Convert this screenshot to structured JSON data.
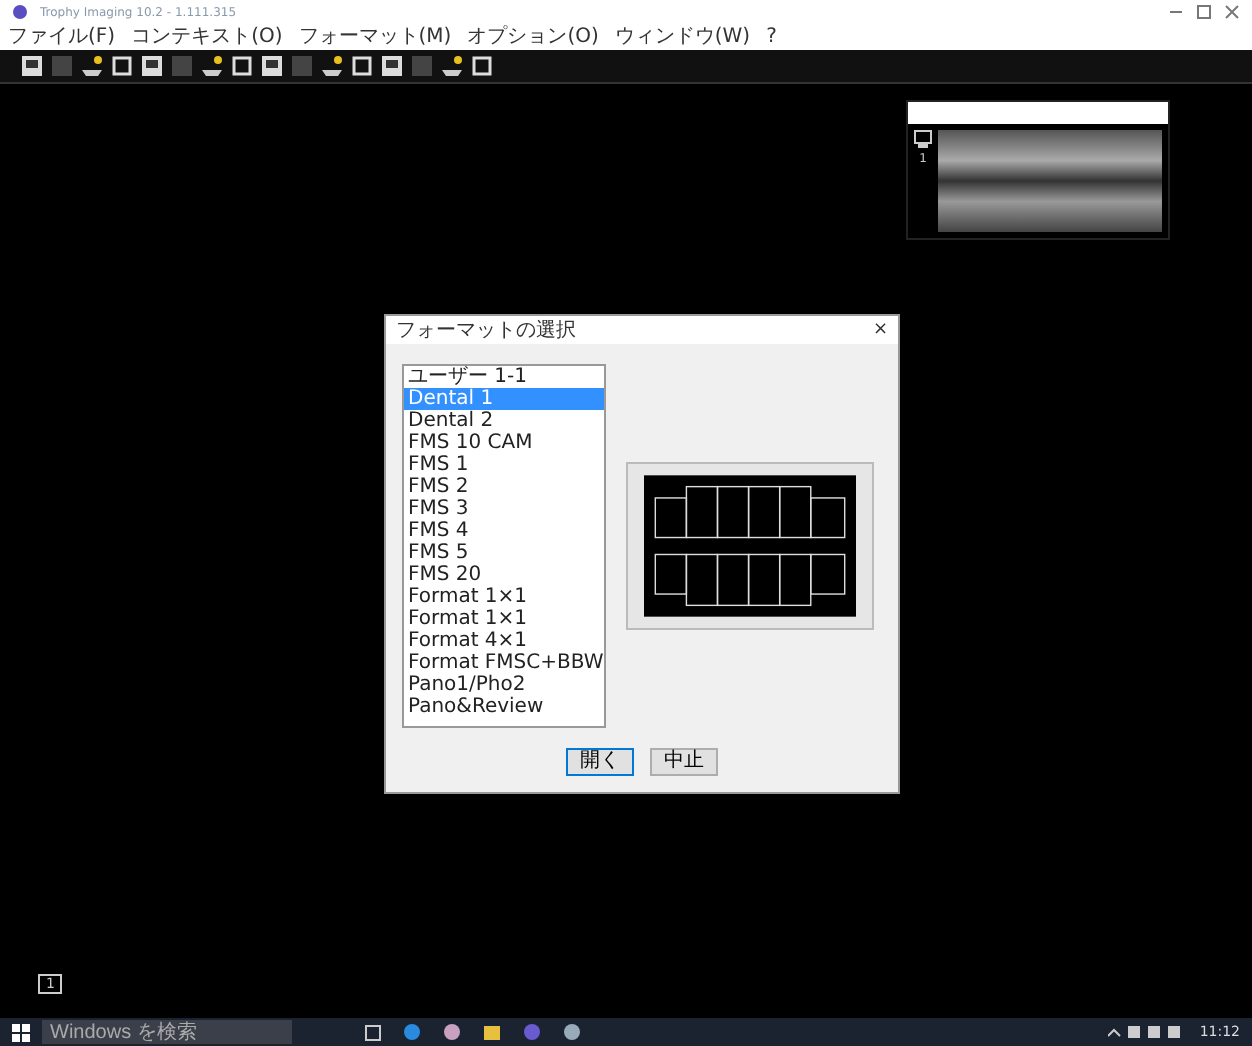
{
  "window": {
    "title": "Trophy Imaging 10.2 - 1.111.315"
  },
  "menu": [
    "ファイル(F)",
    "コンテキスト(O)",
    "フォーマット(M)",
    "オプション(O)",
    "ウィンドウ(W)",
    "?"
  ],
  "dialog": {
    "title": "フォーマットの選択",
    "close": "×",
    "items": [
      {
        "label": "ユーザー 1-1",
        "selected": false
      },
      {
        "label": "Dental 1",
        "selected": true
      },
      {
        "label": "Dental 2",
        "selected": false
      },
      {
        "label": "FMS 10 CAM",
        "selected": false
      },
      {
        "label": "FMS 1",
        "selected": false
      },
      {
        "label": "FMS 2",
        "selected": false
      },
      {
        "label": "FMS 3",
        "selected": false
      },
      {
        "label": "FMS 4",
        "selected": false
      },
      {
        "label": "FMS 5",
        "selected": false
      },
      {
        "label": "FMS 20",
        "selected": false
      },
      {
        "label": "Format 1×1",
        "selected": false
      },
      {
        "label": "Format 1×1",
        "selected": false
      },
      {
        "label": "Format 4×1",
        "selected": false
      },
      {
        "label": "Format FMSC+BBW",
        "selected": false
      },
      {
        "label": "Pano1/Pho2",
        "selected": false
      },
      {
        "label": "Pano&Review",
        "selected": false
      }
    ],
    "buttons": [
      {
        "label": "開く",
        "default": true
      },
      {
        "label": "中止",
        "default": false
      }
    ]
  },
  "thumbnail": {
    "index": "1"
  },
  "page_indicator": "1",
  "taskbar": {
    "search": {
      "placeholder": "Windows を検索"
    },
    "clock": "11:12"
  }
}
